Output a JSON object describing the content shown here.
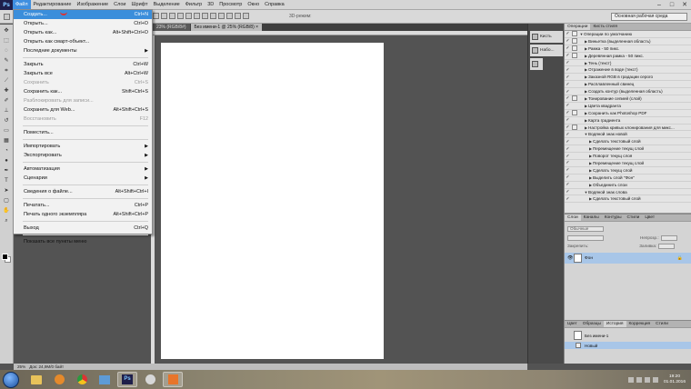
{
  "app": {
    "logo": "Ps"
  },
  "menubar": {
    "items": [
      "Файл",
      "Редактирование",
      "Изображение",
      "Слои",
      "Шрифт",
      "Выделение",
      "Фильтр",
      "3D",
      "Просмотр",
      "Окно",
      "Справка"
    ],
    "active_index": 0
  },
  "options_bar": {
    "auto_select_label": "3D-режим:",
    "workspace": "Основная рабочая среда"
  },
  "document": {
    "tabs": [
      {
        "label": "23% (RGB/8#)",
        "active": false
      },
      {
        "label": "Без имени-1 @ 25% (RGB/8) ×",
        "active": true
      }
    ],
    "status_zoom": "25%",
    "status_doc": "Док: 24,9M/0 байт"
  },
  "file_menu": {
    "groups": [
      [
        {
          "label": "Создать...",
          "shortcut": "Ctrl+N",
          "disabled": false,
          "highlight": true,
          "submenu": false
        },
        {
          "label": "Открыть...",
          "shortcut": "Ctrl+O",
          "disabled": false,
          "highlight": false,
          "submenu": false
        },
        {
          "label": "Открыть как...",
          "shortcut": "Alt+Shift+Ctrl+O",
          "disabled": false,
          "highlight": false,
          "submenu": false
        },
        {
          "label": "Открыть как смарт-объект...",
          "shortcut": "",
          "disabled": false,
          "highlight": false,
          "submenu": false
        },
        {
          "label": "Последние документы",
          "shortcut": "",
          "disabled": false,
          "highlight": false,
          "submenu": true
        }
      ],
      [
        {
          "label": "Закрыть",
          "shortcut": "Ctrl+W",
          "disabled": false,
          "highlight": false,
          "submenu": false
        },
        {
          "label": "Закрыть все",
          "shortcut": "Alt+Ctrl+W",
          "disabled": false,
          "highlight": false,
          "submenu": false
        },
        {
          "label": "Сохранить",
          "shortcut": "Ctrl+S",
          "disabled": true,
          "highlight": false,
          "submenu": false
        },
        {
          "label": "Сохранить как...",
          "shortcut": "Shift+Ctrl+S",
          "disabled": false,
          "highlight": false,
          "submenu": false
        },
        {
          "label": "Разблокировать для записи...",
          "shortcut": "",
          "disabled": true,
          "highlight": false,
          "submenu": false
        },
        {
          "label": "Сохранить для Web...",
          "shortcut": "Alt+Shift+Ctrl+S",
          "disabled": false,
          "highlight": false,
          "submenu": false
        },
        {
          "label": "Восстановить",
          "shortcut": "F12",
          "disabled": true,
          "highlight": false,
          "submenu": false
        }
      ],
      [
        {
          "label": "Поместить...",
          "shortcut": "",
          "disabled": false,
          "highlight": false,
          "submenu": false
        }
      ],
      [
        {
          "label": "Импортировать",
          "shortcut": "",
          "disabled": false,
          "highlight": false,
          "submenu": true
        },
        {
          "label": "Экспортировать",
          "shortcut": "",
          "disabled": false,
          "highlight": false,
          "submenu": true
        }
      ],
      [
        {
          "label": "Автоматизация",
          "shortcut": "",
          "disabled": false,
          "highlight": false,
          "submenu": true
        },
        {
          "label": "Сценарии",
          "shortcut": "",
          "disabled": false,
          "highlight": false,
          "submenu": true
        }
      ],
      [
        {
          "label": "Сведения о файле...",
          "shortcut": "Alt+Shift+Ctrl+I",
          "disabled": false,
          "highlight": false,
          "submenu": false
        }
      ],
      [
        {
          "label": "Печатать...",
          "shortcut": "Ctrl+P",
          "disabled": false,
          "highlight": false,
          "submenu": false
        },
        {
          "label": "Печать одного экземпляра",
          "shortcut": "Alt+Shift+Ctrl+P",
          "disabled": false,
          "highlight": false,
          "submenu": false
        }
      ],
      [
        {
          "label": "Выход",
          "shortcut": "Ctrl+Q",
          "disabled": false,
          "highlight": false,
          "submenu": false
        }
      ],
      [
        {
          "label": "Показать все пункты меню",
          "shortcut": "",
          "disabled": false,
          "highlight": false,
          "submenu": false
        }
      ]
    ]
  },
  "mini_panels": [
    {
      "label": "Кисть"
    },
    {
      "label": "Набо..."
    }
  ],
  "actions_panel": {
    "tabs": [
      "Операции",
      "Кисть стиля"
    ],
    "active_tab": 0,
    "rows": [
      {
        "label": "Операции по умолчанию",
        "indent": 0,
        "expanded": true,
        "box": true
      },
      {
        "label": "Виньетка (выделенная область)",
        "indent": 1,
        "expanded": false,
        "box": true
      },
      {
        "label": "Рамка - 50 пикс.",
        "indent": 1,
        "expanded": false,
        "box": true
      },
      {
        "label": "Деревянная рамка - 50 пикс.",
        "indent": 1,
        "expanded": false,
        "box": true
      },
      {
        "label": "Тень (текст)",
        "indent": 1,
        "expanded": false,
        "box": false
      },
      {
        "label": "Отражение в воде (текст)",
        "indent": 1,
        "expanded": false,
        "box": false
      },
      {
        "label": "Заказной RGB в градации серого",
        "indent": 1,
        "expanded": false,
        "box": false
      },
      {
        "label": "Расплавленный свинец",
        "indent": 1,
        "expanded": false,
        "box": false
      },
      {
        "label": "Создать контур (выделенная область)",
        "indent": 1,
        "expanded": false,
        "box": false
      },
      {
        "label": "Тонирование сепией (слой)",
        "indent": 1,
        "expanded": false,
        "box": true
      },
      {
        "label": "Цвета квадранта",
        "indent": 1,
        "expanded": false,
        "box": false
      },
      {
        "label": "Сохранить как Photoshop PDF",
        "indent": 1,
        "expanded": false,
        "box": true
      },
      {
        "label": "Карта градиента",
        "indent": 1,
        "expanded": false,
        "box": false
      },
      {
        "label": "Настройка кривых клонирования для микс...",
        "indent": 1,
        "expanded": false,
        "box": true
      },
      {
        "label": "Водяной знак новой",
        "indent": 1,
        "expanded": true,
        "box": false
      },
      {
        "label": "Сделать текстовый слой",
        "indent": 2,
        "expanded": false,
        "box": false
      },
      {
        "label": "Перемещение текущ слой",
        "indent": 2,
        "expanded": false,
        "box": false
      },
      {
        "label": "Поворот текущ слоя",
        "indent": 2,
        "expanded": false,
        "box": false
      },
      {
        "label": "Перемещение текущ слой",
        "indent": 2,
        "expanded": false,
        "box": false
      },
      {
        "label": "Сделать текущ слой",
        "indent": 2,
        "expanded": false,
        "box": false
      },
      {
        "label": "Выделить слой \"Фон\"",
        "indent": 2,
        "expanded": false,
        "box": false
      },
      {
        "label": "Объединить слои",
        "indent": 2,
        "expanded": false,
        "box": false
      },
      {
        "label": "Водяной знак слова",
        "indent": 1,
        "expanded": true,
        "box": false
      },
      {
        "label": "Сделать текстовый слой",
        "indent": 2,
        "expanded": false,
        "box": false
      }
    ]
  },
  "layers_panel": {
    "tabs": [
      "Слои",
      "Каналы",
      "Контуры",
      "Стили",
      "Цвет"
    ],
    "active_tab": 0,
    "kind_label": "Обычные",
    "opacity_label": "Непрозр.:",
    "fill_label": "Заливка:",
    "lock_label": "Закрепить:",
    "layer_name": "Фон"
  },
  "history_panel": {
    "tabs": [
      "Цвет",
      "Образцы",
      "История",
      "Коррекция",
      "Стили"
    ],
    "active_tab": 2,
    "snapshot": "Без имени-1",
    "current": "Новый"
  },
  "taskbar": {
    "time": "19:20",
    "date": "01.01.2016",
    "ps_label": "Ps"
  },
  "colors": {
    "accent": "#3b8edb",
    "canvas": "#ffffff",
    "workspace": "#535353"
  }
}
